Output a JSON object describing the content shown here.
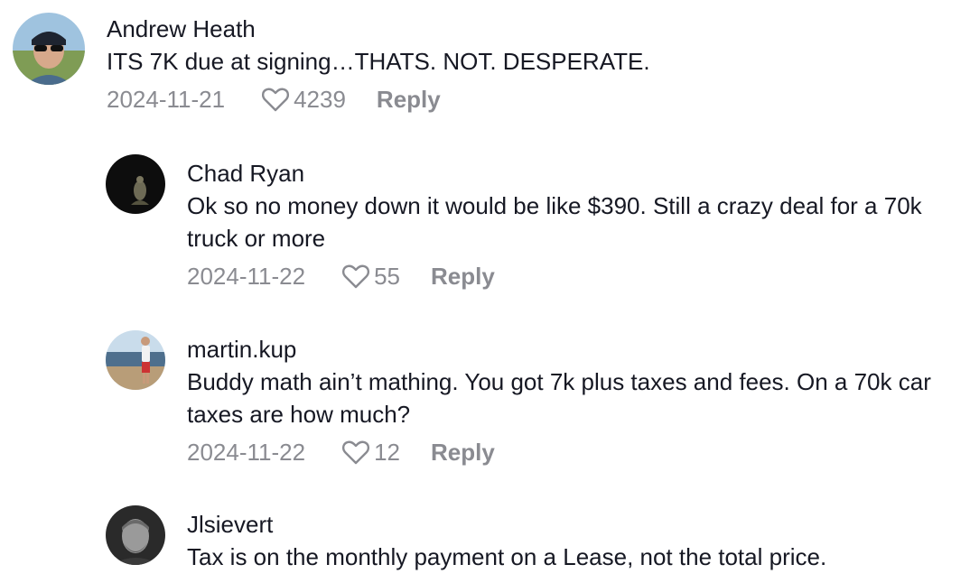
{
  "comments": [
    {
      "username": "Andrew Heath",
      "text": "ITS 7K due at signing…THATS. NOT. DESPERATE.",
      "date": "2024-11-21",
      "likes": "4239",
      "reply_label": "Reply"
    },
    {
      "username": "Chad Ryan",
      "text": "Ok so no money down it would be like $390. Still a crazy deal for a 70k truck or more",
      "date": "2024-11-22",
      "likes": "55",
      "reply_label": "Reply"
    },
    {
      "username": "martin.kup",
      "text": "Buddy math ain’t mathing. You got 7k plus taxes and fees. On a 70k car taxes are how much?",
      "date": "2024-11-22",
      "likes": "12",
      "reply_label": "Reply"
    },
    {
      "username": "Jlsievert",
      "text": "Tax is on the monthly payment on a Lease, not the total price."
    }
  ],
  "icons": {
    "like": "heart-outline-icon"
  },
  "colors": {
    "text": "#161823",
    "secondary": "#8a8b91",
    "background": "#ffffff"
  }
}
